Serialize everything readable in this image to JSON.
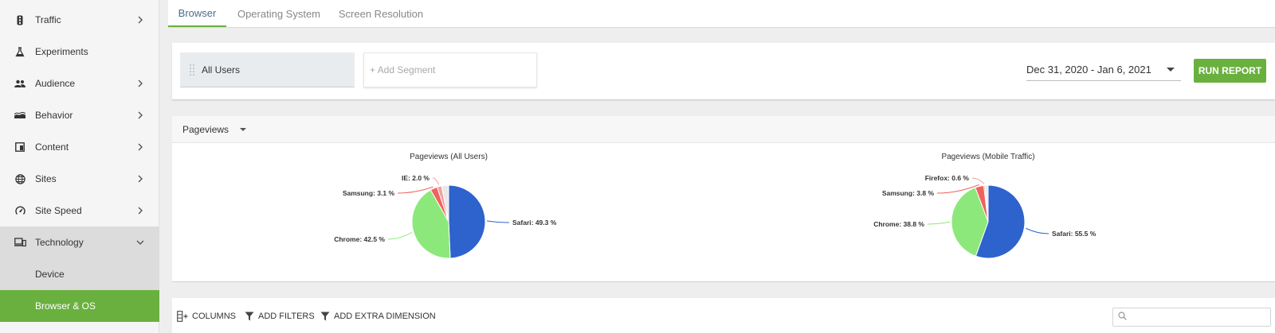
{
  "sidebar": {
    "items": [
      {
        "label": "Traffic",
        "icon": "traffic-light-icon",
        "chevron": "right"
      },
      {
        "label": "Experiments",
        "icon": "flask-icon",
        "chevron": ""
      },
      {
        "label": "Audience",
        "icon": "people-icon",
        "chevron": "right"
      },
      {
        "label": "Behavior",
        "icon": "wave-icon",
        "chevron": "right"
      },
      {
        "label": "Content",
        "icon": "content-icon",
        "chevron": "right"
      },
      {
        "label": "Sites",
        "icon": "globe-icon",
        "chevron": "right"
      },
      {
        "label": "Site Speed",
        "icon": "speedometer-icon",
        "chevron": "right"
      },
      {
        "label": "Technology",
        "icon": "devices-icon",
        "chevron": "down"
      }
    ],
    "subitems": [
      {
        "label": "Device"
      },
      {
        "label": "Browser & OS"
      }
    ]
  },
  "tabs": [
    {
      "label": "Browser"
    },
    {
      "label": "Operating System"
    },
    {
      "label": "Screen Resolution"
    }
  ],
  "segments": {
    "all_users": "All Users",
    "add_segment": "+ Add Segment"
  },
  "date_range": "Dec 31, 2020 - Jan 6, 2021",
  "run_report": "RUN REPORT",
  "metric_selector": "Pageviews",
  "colors": {
    "accent": "#6ab03f",
    "safari": "#2e62cd",
    "chrome": "#8de87c",
    "samsung": "#f0625e",
    "other": "#f0a09e"
  },
  "chart_data": [
    {
      "type": "pie",
      "title": "Pageviews (All Users)",
      "slices": [
        {
          "label": "Safari: 49.3 %",
          "value": 49.3,
          "color": "#2e62cd"
        },
        {
          "label": "Chrome: 42.5 %",
          "value": 42.5,
          "color": "#8de87c"
        },
        {
          "label": "Samsung: 3.1 %",
          "value": 3.1,
          "color": "#f0625e"
        },
        {
          "label": "IE: 2.0 %",
          "value": 2.0,
          "color": "#f0a09e"
        },
        {
          "label": "",
          "value": 3.1,
          "color": "#e8e8e8"
        }
      ]
    },
    {
      "type": "pie",
      "title": "Pageviews (Mobile Traffic)",
      "slices": [
        {
          "label": "Safari: 55.5 %",
          "value": 55.5,
          "color": "#2e62cd"
        },
        {
          "label": "Chrome: 38.8 %",
          "value": 38.8,
          "color": "#8de87c"
        },
        {
          "label": "Samsung: 3.8 %",
          "value": 3.8,
          "color": "#f0625e"
        },
        {
          "label": "Firefox: 0.6 %",
          "value": 0.6,
          "color": "#f0a09e"
        },
        {
          "label": "",
          "value": 1.3,
          "color": "#e8e8e8"
        }
      ]
    }
  ],
  "toolbar": {
    "columns": "COLUMNS",
    "add_filters": "ADD FILTERS",
    "add_extra_dimension": "ADD EXTRA DIMENSION"
  }
}
